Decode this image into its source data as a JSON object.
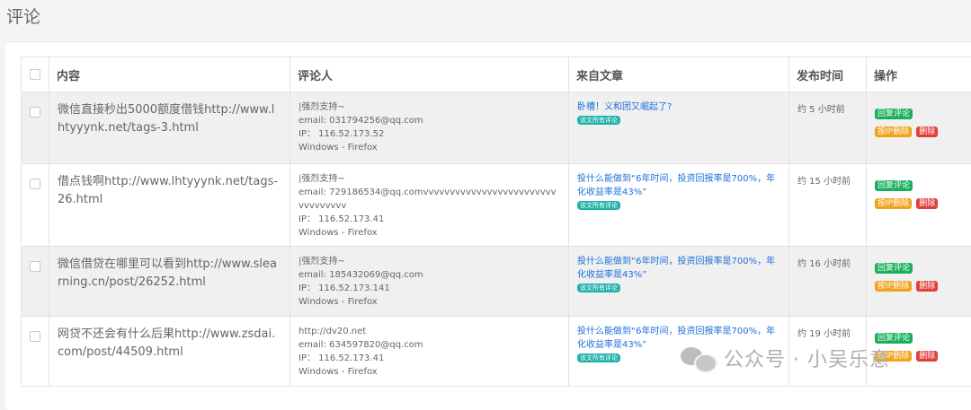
{
  "page": {
    "title": "评论"
  },
  "table": {
    "headers": {
      "content": "内容",
      "commenter": "评论人",
      "article": "来自文章",
      "time": "发布时间",
      "ops": "操作"
    },
    "all_comments_tag": "该文所有评论",
    "ops_labels": {
      "reply": "回复评论",
      "delete_by_ip": "按IP删除",
      "delete": "删除"
    },
    "rows": [
      {
        "content": "微信直接秒出5000额度借钱http://www.lhtyyynk.net/tags-3.html",
        "commenter_name": "|强烈支持~",
        "commenter_email": "email: 031794256@qq.com",
        "commenter_ip": "IP： 116.52.173.52",
        "commenter_ua": "Windows - Firefox",
        "article": "卧槽！义和团又崛起了?",
        "time": "约 5 小时前"
      },
      {
        "content": "借点钱啊http://www.lhtyyynk.net/tags-26.html",
        "commenter_name": "|强烈支持~",
        "commenter_email": "email: 729186534@qq.comvvvvvvvvvvvvvvvvvvvvvvvvvvvvvvvvvv",
        "commenter_ip": "IP： 116.52.173.41",
        "commenter_ua": "Windows - Firefox",
        "article": "投什么能做到“6年时间，投资回报率是700%，年化收益率是43%”",
        "time": "约 15 小时前"
      },
      {
        "content": "微信借贷在哪里可以看到http://www.slearning.cn/post/26252.html",
        "commenter_name": "|强烈支持~",
        "commenter_email": "email: 185432069@qq.com",
        "commenter_ip": "IP： 116.52.173.141",
        "commenter_ua": "Windows - Firefox",
        "article": "投什么能做到“6年时间，投资回报率是700%，年化收益率是43%”",
        "time": "约 16 小时前"
      },
      {
        "content": "网贷不还会有什么后果http://www.zsdai.com/post/44509.html",
        "commenter_name": "http://dv20.net",
        "commenter_email": "email: 634597820@qq.com",
        "commenter_ip": "IP： 116.52.173.41",
        "commenter_ua": "Windows - Firefox",
        "article": "投什么能做到“6年时间，投资回报率是700%，年化收益率是43%”",
        "time": "约 19 小时前"
      }
    ]
  },
  "watermark": {
    "text": "公众号 · 小吴乐意"
  }
}
